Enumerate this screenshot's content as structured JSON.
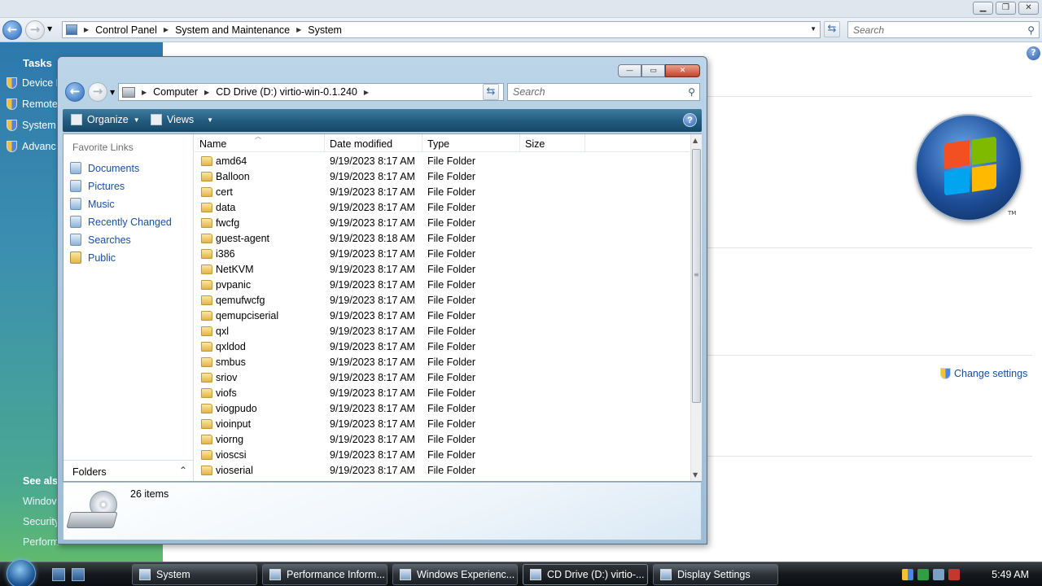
{
  "background_window": {
    "breadcrumb": [
      "Control Panel",
      "System and Maintenance",
      "System"
    ],
    "search_placeholder": "Search",
    "tasks_heading": "Tasks",
    "tasks": [
      "Device M",
      "Remote",
      "System",
      "Advanc"
    ],
    "see_also_heading": "See als",
    "see_also": [
      "Windov",
      "Security",
      "Perform"
    ],
    "change_settings": "Change settings",
    "trademark": "TM",
    "help": "?"
  },
  "explorer": {
    "breadcrumb": [
      "Computer",
      "CD Drive (D:) virtio-win-0.1.240"
    ],
    "search_placeholder": "Search",
    "toolbar": {
      "organize": "Organize",
      "views": "Views",
      "help": "?"
    },
    "window_buttons": {
      "minimize": "—",
      "maximize": "▭",
      "close": "✕"
    },
    "favorite_links_heading": "Favorite Links",
    "favorite_links": [
      "Documents",
      "Pictures",
      "Music",
      "Recently Changed",
      "Searches",
      "Public"
    ],
    "folders_label": "Folders",
    "columns": [
      "Name",
      "Date modified",
      "Type",
      "Size"
    ],
    "files": [
      {
        "name": "amd64",
        "date": "9/19/2023 8:17 AM",
        "type": "File Folder"
      },
      {
        "name": "Balloon",
        "date": "9/19/2023 8:17 AM",
        "type": "File Folder"
      },
      {
        "name": "cert",
        "date": "9/19/2023 8:17 AM",
        "type": "File Folder"
      },
      {
        "name": "data",
        "date": "9/19/2023 8:17 AM",
        "type": "File Folder"
      },
      {
        "name": "fwcfg",
        "date": "9/19/2023 8:17 AM",
        "type": "File Folder"
      },
      {
        "name": "guest-agent",
        "date": "9/19/2023 8:18 AM",
        "type": "File Folder"
      },
      {
        "name": "i386",
        "date": "9/19/2023 8:17 AM",
        "type": "File Folder"
      },
      {
        "name": "NetKVM",
        "date": "9/19/2023 8:17 AM",
        "type": "File Folder"
      },
      {
        "name": "pvpanic",
        "date": "9/19/2023 8:17 AM",
        "type": "File Folder"
      },
      {
        "name": "qemufwcfg",
        "date": "9/19/2023 8:17 AM",
        "type": "File Folder"
      },
      {
        "name": "qemupciserial",
        "date": "9/19/2023 8:17 AM",
        "type": "File Folder"
      },
      {
        "name": "qxl",
        "date": "9/19/2023 8:17 AM",
        "type": "File Folder"
      },
      {
        "name": "qxldod",
        "date": "9/19/2023 8:17 AM",
        "type": "File Folder"
      },
      {
        "name": "smbus",
        "date": "9/19/2023 8:17 AM",
        "type": "File Folder"
      },
      {
        "name": "sriov",
        "date": "9/19/2023 8:17 AM",
        "type": "File Folder"
      },
      {
        "name": "viofs",
        "date": "9/19/2023 8:17 AM",
        "type": "File Folder"
      },
      {
        "name": "viogpudo",
        "date": "9/19/2023 8:17 AM",
        "type": "File Folder"
      },
      {
        "name": "vioinput",
        "date": "9/19/2023 8:17 AM",
        "type": "File Folder"
      },
      {
        "name": "viorng",
        "date": "9/19/2023 8:17 AM",
        "type": "File Folder"
      },
      {
        "name": "vioscsi",
        "date": "9/19/2023 8:17 AM",
        "type": "File Folder"
      },
      {
        "name": "vioserial",
        "date": "9/19/2023 8:17 AM",
        "type": "File Folder"
      }
    ],
    "item_count": "26 items"
  },
  "taskbar": {
    "buttons": [
      "System",
      "Performance Inform...",
      "Windows Experienc...",
      "CD Drive (D:) virtio-...",
      "Display Settings"
    ],
    "active_index": 3,
    "clock": "5:49 AM"
  },
  "colors": {
    "link": "#1a4fa0",
    "toolbar": "#245c80",
    "taskbar": "#15191d"
  }
}
